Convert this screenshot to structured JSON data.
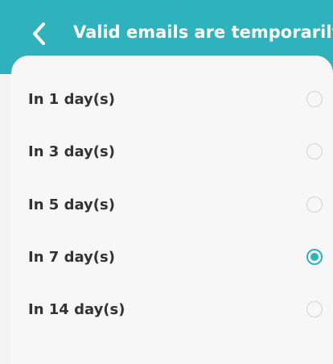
{
  "header": {
    "title": "Valid emails are temporarily...",
    "back_icon": "chevron-left-icon",
    "background_color": "#2fb2bd"
  },
  "options": [
    {
      "label": "In 1 day(s)",
      "selected": false
    },
    {
      "label": "In 3 day(s)",
      "selected": false
    },
    {
      "label": "In 5 day(s)",
      "selected": false
    },
    {
      "label": "In 7 day(s)",
      "selected": true
    },
    {
      "label": "In 14 day(s)",
      "selected": false
    }
  ],
  "accent_color": "#2fb2bd"
}
